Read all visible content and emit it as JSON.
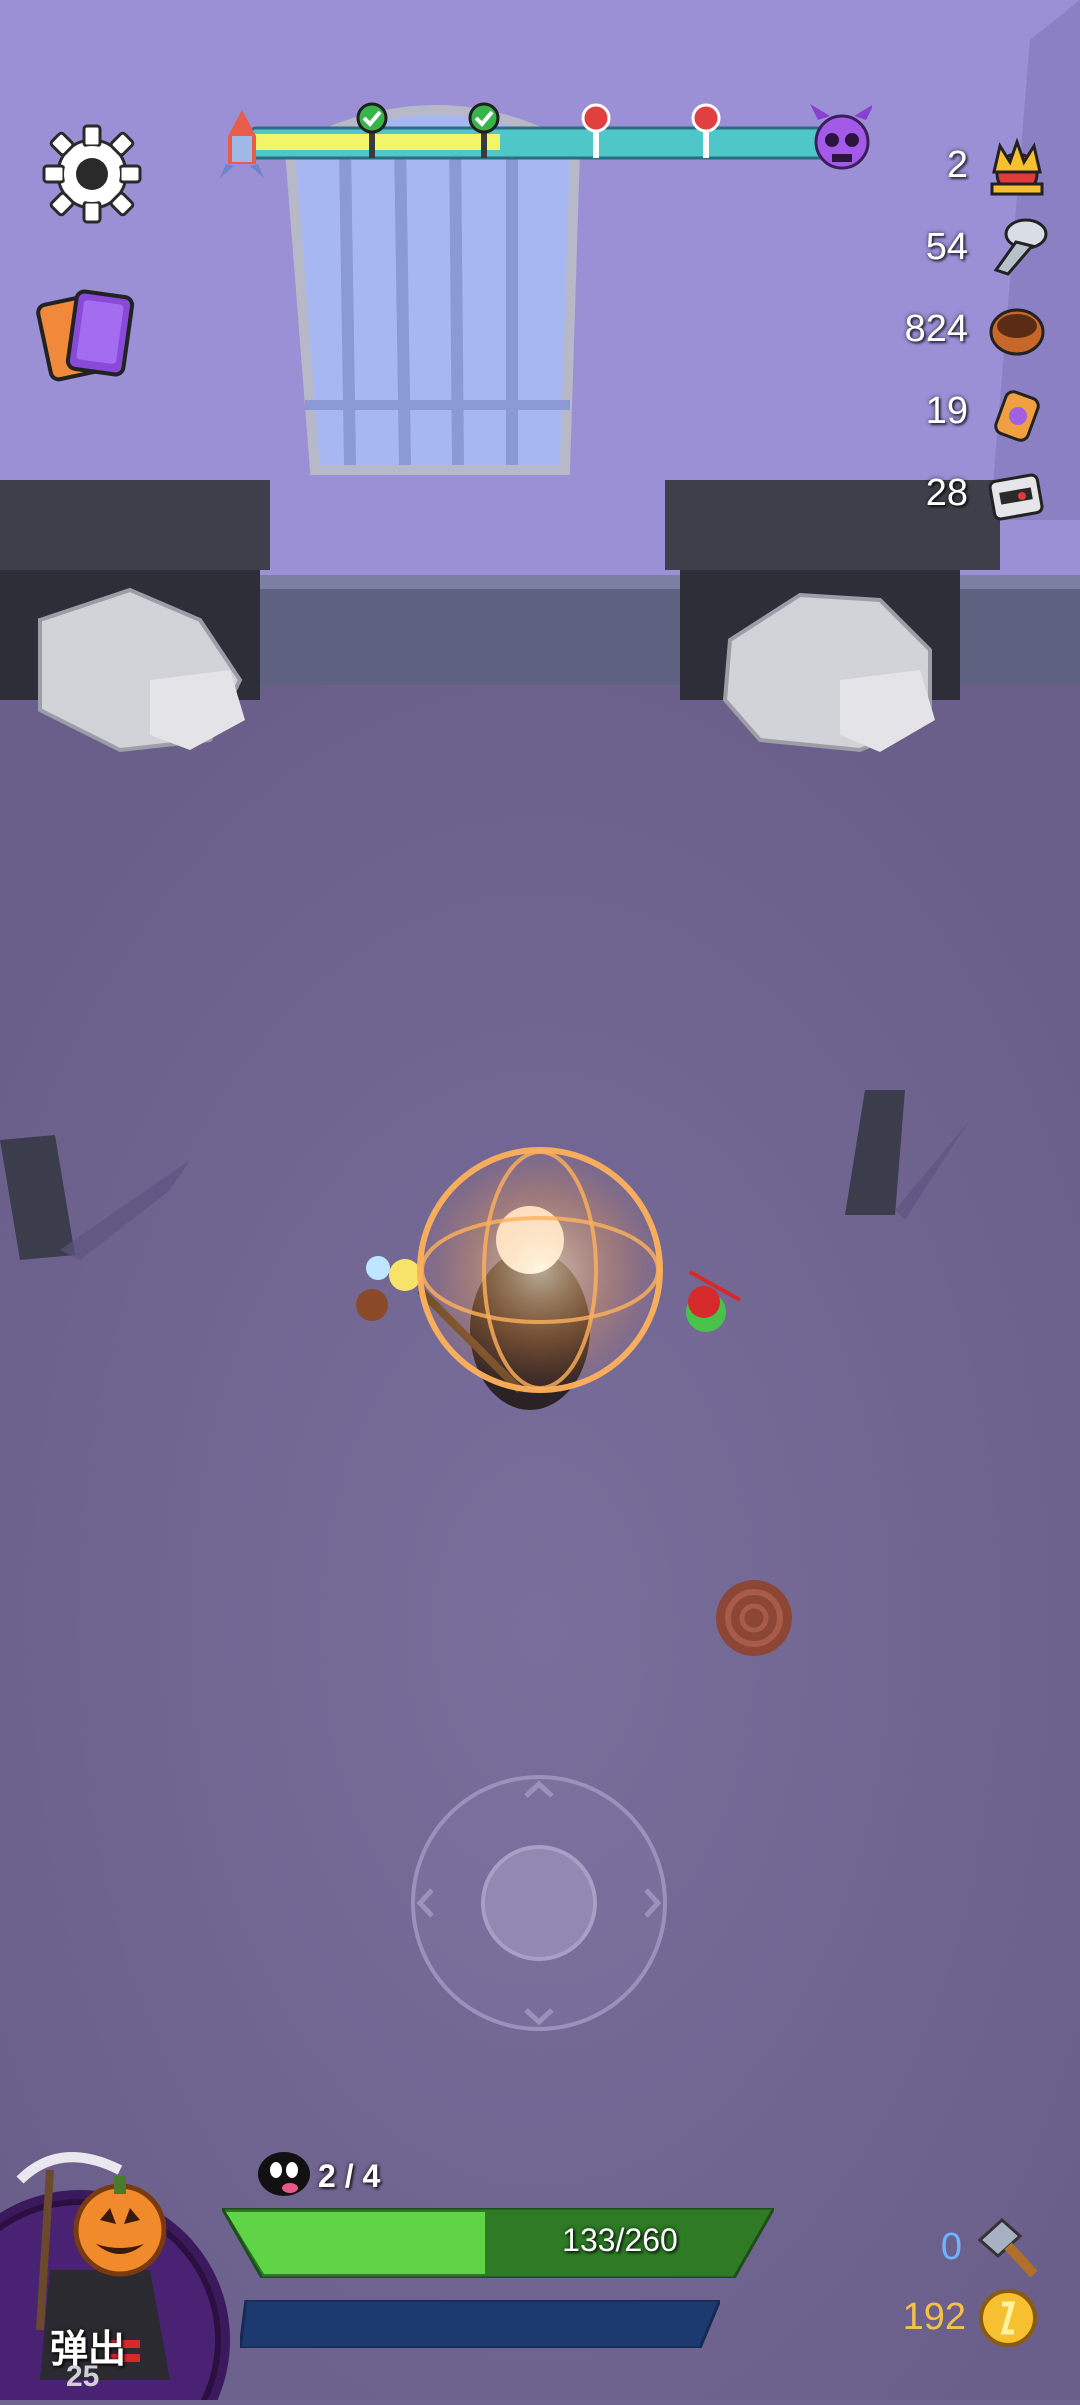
{
  "wave_progress": {
    "checkpoints_done": 2,
    "checkpoints_total": 4
  },
  "resources": [
    {
      "id": "crowns",
      "value": "2",
      "icon": "crown-icon"
    },
    {
      "id": "bolts",
      "value": "54",
      "icon": "bolt-icon"
    },
    {
      "id": "coffee",
      "value": "824",
      "icon": "coffee-cup-icon"
    },
    {
      "id": "potion",
      "value": "19",
      "icon": "potion-jar-icon"
    },
    {
      "id": "robot",
      "value": "28",
      "icon": "robot-head-icon"
    }
  ],
  "hud": {
    "enemy_count": "2 / 4",
    "hp_text": "133/260",
    "hp_fraction": 0.51,
    "eject_label": "弹出",
    "eject_count": "25",
    "hammer_count": "0",
    "gold_count": "192"
  },
  "colors": {
    "hp_fill": "#5fd446",
    "hp_bg": "#2e7a25",
    "xp_bg": "#1c3970",
    "gold_text": "#f6c14a",
    "hammer_text": "#6fb4ff"
  }
}
